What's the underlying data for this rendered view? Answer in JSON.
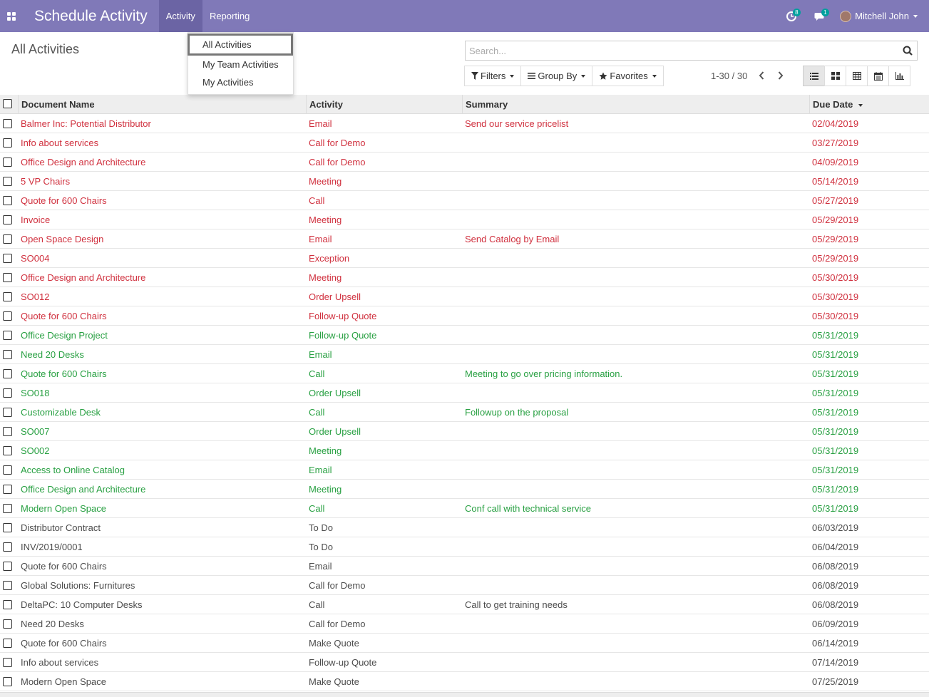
{
  "navbar": {
    "brand": "Schedule Activity",
    "menu": [
      "Activity",
      "Reporting"
    ],
    "activity_badge": "8",
    "message_badge": "1",
    "user_name": "Mitchell John"
  },
  "page": {
    "title": "All Activities"
  },
  "search": {
    "placeholder": "Search..."
  },
  "filters": {
    "filters_label": "Filters",
    "group_by_label": "Group By",
    "favorites_label": "Favorites"
  },
  "pager": {
    "text": "1-30 / 30"
  },
  "dropdown": {
    "items": [
      "All Activities",
      "My Team Activities",
      "My Activities"
    ]
  },
  "table": {
    "headers": [
      "Document Name",
      "Activity",
      "Summary",
      "Due Date"
    ],
    "status_colors": {
      "overdue": "#d0303e",
      "today": "#28a042",
      "planned": "#4c4c4c"
    },
    "rows": [
      {
        "doc": "Balmer Inc: Potential Distributor",
        "activity": "Email",
        "summary": "Send our service pricelist",
        "due": "02/04/2019",
        "status": "overdue"
      },
      {
        "doc": "Info about services",
        "activity": "Call for Demo",
        "summary": "",
        "due": "03/27/2019",
        "status": "overdue"
      },
      {
        "doc": "Office Design and Architecture",
        "activity": "Call for Demo",
        "summary": "",
        "due": "04/09/2019",
        "status": "overdue"
      },
      {
        "doc": "5 VP Chairs",
        "activity": "Meeting",
        "summary": "",
        "due": "05/14/2019",
        "status": "overdue"
      },
      {
        "doc": "Quote for 600 Chairs",
        "activity": "Call",
        "summary": "",
        "due": "05/27/2019",
        "status": "overdue"
      },
      {
        "doc": "Invoice",
        "activity": "Meeting",
        "summary": "",
        "due": "05/29/2019",
        "status": "overdue"
      },
      {
        "doc": "Open Space Design",
        "activity": "Email",
        "summary": "Send Catalog by Email",
        "due": "05/29/2019",
        "status": "overdue"
      },
      {
        "doc": "SO004",
        "activity": "Exception",
        "summary": "",
        "due": "05/29/2019",
        "status": "overdue"
      },
      {
        "doc": "Office Design and Architecture",
        "activity": "Meeting",
        "summary": "",
        "due": "05/30/2019",
        "status": "overdue"
      },
      {
        "doc": "SO012",
        "activity": "Order Upsell",
        "summary": "",
        "due": "05/30/2019",
        "status": "overdue"
      },
      {
        "doc": "Quote for 600 Chairs",
        "activity": "Follow-up Quote",
        "summary": "",
        "due": "05/30/2019",
        "status": "overdue"
      },
      {
        "doc": "Office Design Project",
        "activity": "Follow-up Quote",
        "summary": "",
        "due": "05/31/2019",
        "status": "today"
      },
      {
        "doc": "Need 20 Desks",
        "activity": "Email",
        "summary": "",
        "due": "05/31/2019",
        "status": "today"
      },
      {
        "doc": "Quote for 600 Chairs",
        "activity": "Call",
        "summary": "Meeting to go over pricing information.",
        "due": "05/31/2019",
        "status": "today"
      },
      {
        "doc": "SO018",
        "activity": "Order Upsell",
        "summary": "",
        "due": "05/31/2019",
        "status": "today"
      },
      {
        "doc": "Customizable Desk",
        "activity": "Call",
        "summary": "Followup on the proposal",
        "due": "05/31/2019",
        "status": "today"
      },
      {
        "doc": "SO007",
        "activity": "Order Upsell",
        "summary": "",
        "due": "05/31/2019",
        "status": "today"
      },
      {
        "doc": "SO002",
        "activity": "Meeting",
        "summary": "",
        "due": "05/31/2019",
        "status": "today"
      },
      {
        "doc": "Access to Online Catalog",
        "activity": "Email",
        "summary": "",
        "due": "05/31/2019",
        "status": "today"
      },
      {
        "doc": "Office Design and Architecture",
        "activity": "Meeting",
        "summary": "",
        "due": "05/31/2019",
        "status": "today"
      },
      {
        "doc": "Modern Open Space",
        "activity": "Call",
        "summary": "Conf call with technical service",
        "due": "05/31/2019",
        "status": "today"
      },
      {
        "doc": "Distributor Contract",
        "activity": "To Do",
        "summary": "",
        "due": "06/03/2019",
        "status": "planned"
      },
      {
        "doc": "INV/2019/0001",
        "activity": "To Do",
        "summary": "",
        "due": "06/04/2019",
        "status": "planned"
      },
      {
        "doc": "Quote for 600 Chairs",
        "activity": "Email",
        "summary": "",
        "due": "06/08/2019",
        "status": "planned"
      },
      {
        "doc": "Global Solutions: Furnitures",
        "activity": "Call for Demo",
        "summary": "",
        "due": "06/08/2019",
        "status": "planned"
      },
      {
        "doc": "DeltaPC: 10 Computer Desks",
        "activity": "Call",
        "summary": "Call to get training needs",
        "due": "06/08/2019",
        "status": "planned"
      },
      {
        "doc": "Need 20 Desks",
        "activity": "Call for Demo",
        "summary": "",
        "due": "06/09/2019",
        "status": "planned"
      },
      {
        "doc": "Quote for 600 Chairs",
        "activity": "Make Quote",
        "summary": "",
        "due": "06/14/2019",
        "status": "planned"
      },
      {
        "doc": "Info about services",
        "activity": "Follow-up Quote",
        "summary": "",
        "due": "07/14/2019",
        "status": "planned"
      },
      {
        "doc": "Modern Open Space",
        "activity": "Make Quote",
        "summary": "",
        "due": "07/25/2019",
        "status": "planned"
      }
    ]
  }
}
